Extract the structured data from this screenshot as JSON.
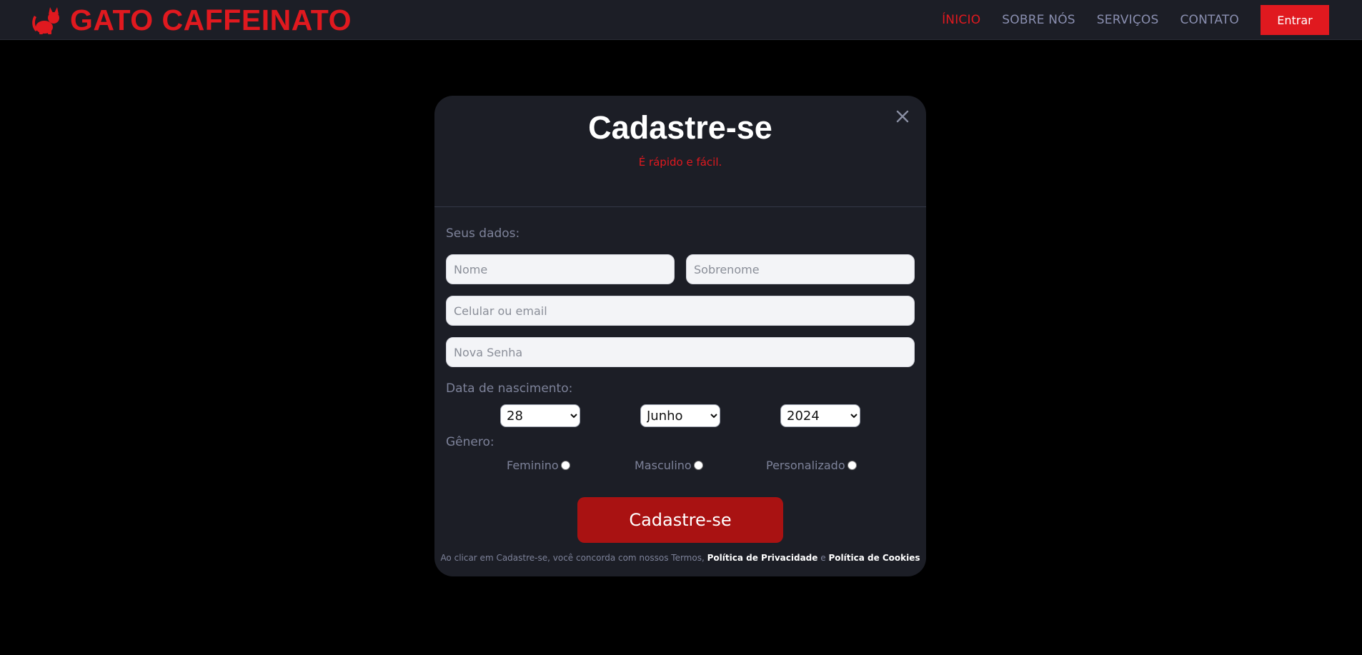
{
  "header": {
    "brand": "GATO CAFFEINATO",
    "nav": [
      "ÍNICIO",
      "SOBRE NÓS",
      "SERVIÇOS",
      "CONTATO"
    ],
    "login_label": "Entrar",
    "accent_color": "#e0191f"
  },
  "modal": {
    "title": "Cadastre-se",
    "subtitle": "É rápido e fácil.",
    "your_data_label": "Seus dados:",
    "first_name_placeholder": "Nome",
    "last_name_placeholder": "Sobrenome",
    "contact_placeholder": "Celular ou email",
    "password_placeholder": "Nova Senha",
    "birth_label": "Data de nascimento:",
    "birth_day": "28",
    "birth_month": "Junho",
    "birth_year": "2024",
    "gender_label": "Gênero:",
    "gender_options": [
      "Feminino",
      "Masculino",
      "Personalizado"
    ],
    "submit_label": "Cadastre-se",
    "terms_prefix": "Ao clicar em Cadastre-se, você concorda com nossos Termos,",
    "privacy_link": "Política de Privacidade",
    "terms_and": "e",
    "cookies_link": "Política de Cookies",
    "submit_color": "#a91212"
  },
  "icons": {
    "brand_icon": "cat-icon",
    "close_icon": "close-icon"
  }
}
